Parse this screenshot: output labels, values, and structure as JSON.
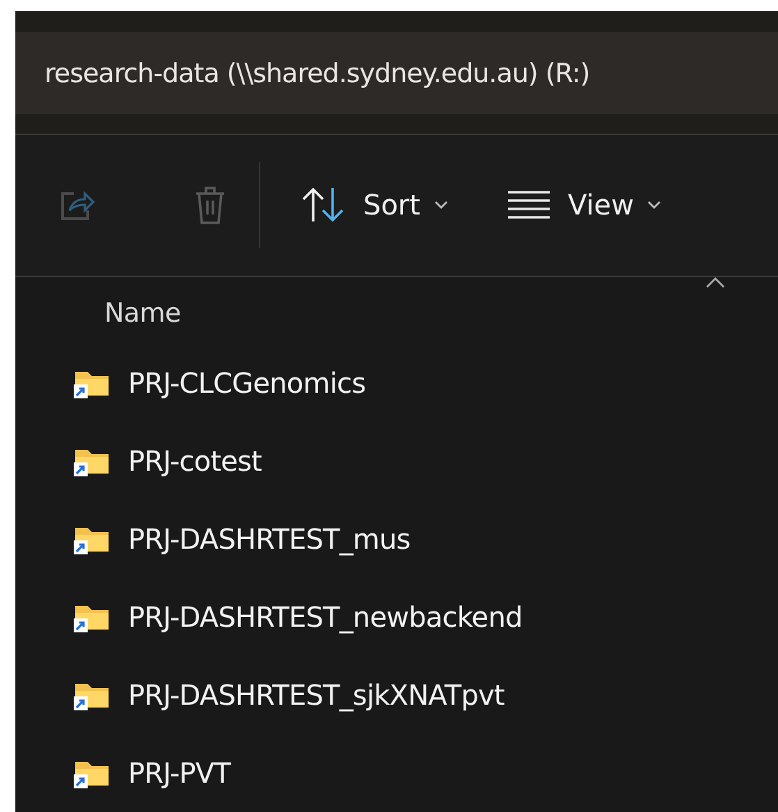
{
  "address_bar": {
    "path": "research-data (\\\\shared.sydney.edu.au) (R:)"
  },
  "toolbar": {
    "buttons": [
      {
        "kind": "share",
        "disabled": true
      },
      {
        "kind": "delete",
        "disabled": true
      },
      {
        "kind": "sort",
        "label": "Sort",
        "disabled": false
      },
      {
        "kind": "view",
        "label": "View",
        "disabled": false
      }
    ]
  },
  "file_list": {
    "columns": [
      {
        "label": "Name",
        "sort_ascending": true
      }
    ],
    "rows": [
      {
        "name": "PRJ-CLCGenomics"
      },
      {
        "name": "PRJ-cotest"
      },
      {
        "name": "PRJ-DASHRTEST_mus"
      },
      {
        "name": "PRJ-DASHRTEST_newbackend"
      },
      {
        "name": "PRJ-DASHRTEST_sjkXNATpvt"
      },
      {
        "name": "PRJ-PVT"
      }
    ]
  }
}
